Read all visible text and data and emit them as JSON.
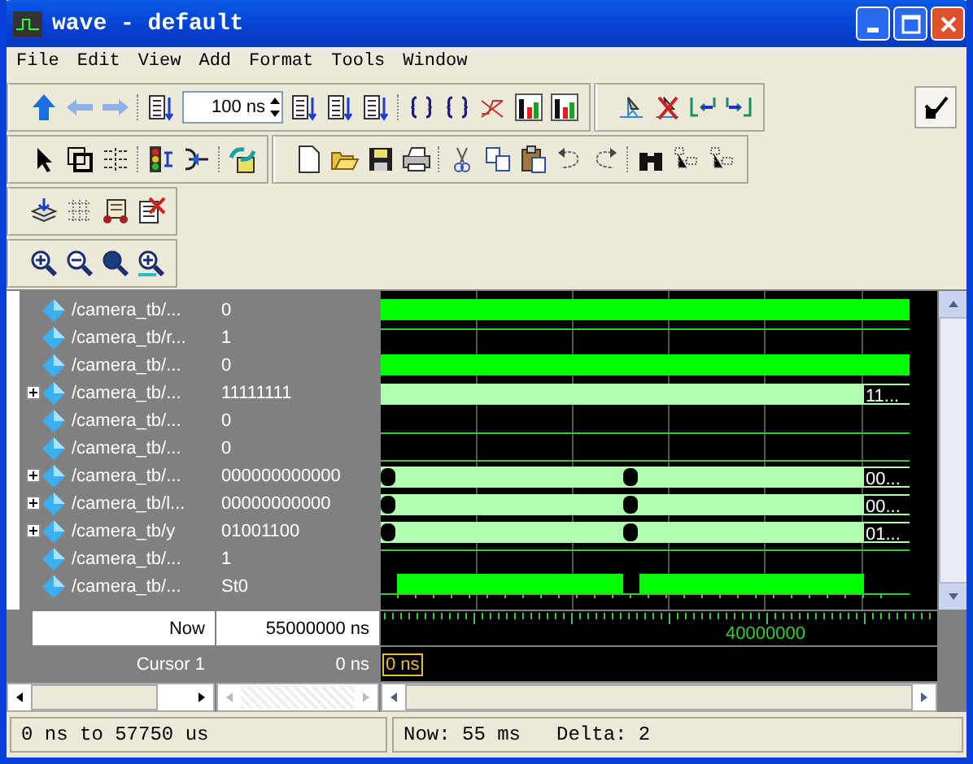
{
  "window": {
    "title": "wave - default"
  },
  "menu": [
    "File",
    "Edit",
    "View",
    "Add",
    "Format",
    "Tools",
    "Window"
  ],
  "toolbar": {
    "time_step": "100 ns"
  },
  "signals": [
    {
      "name": "/camera_tb/...",
      "value": "0",
      "expandable": false,
      "wave": {
        "kind": "block"
      }
    },
    {
      "name": "/camera_tb/r...",
      "value": "1",
      "expandable": false,
      "wave": {
        "kind": "high"
      }
    },
    {
      "name": "/camera_tb/...",
      "value": "0",
      "expandable": false,
      "wave": {
        "kind": "block"
      }
    },
    {
      "name": "/camera_tb/...",
      "value": "11111111",
      "expandable": true,
      "wave": {
        "kind": "bus",
        "end_label": "11..."
      }
    },
    {
      "name": "/camera_tb/...",
      "value": "0",
      "expandable": false,
      "wave": {
        "kind": "low"
      }
    },
    {
      "name": "/camera_tb/...",
      "value": "0",
      "expandable": false,
      "wave": {
        "kind": "low"
      }
    },
    {
      "name": "/camera_tb/...",
      "value": "000000000000",
      "expandable": true,
      "wave": {
        "kind": "bus-change",
        "end_label": "00..."
      }
    },
    {
      "name": "/camera_tb/l...",
      "value": "00000000000",
      "expandable": true,
      "wave": {
        "kind": "bus-change",
        "end_label": "00..."
      }
    },
    {
      "name": "/camera_tb/y",
      "value": "01001100",
      "expandable": true,
      "wave": {
        "kind": "bus-change",
        "end_label": "01..."
      }
    },
    {
      "name": "/camera_tb/...",
      "value": "1",
      "expandable": false,
      "wave": {
        "kind": "high"
      }
    },
    {
      "name": "/camera_tb/...",
      "value": "St0",
      "expandable": false,
      "wave": {
        "kind": "clock"
      }
    }
  ],
  "now": {
    "label": "Now",
    "value": "55000000 ns"
  },
  "timeline": {
    "label": "40000000"
  },
  "cursor": {
    "label": "Cursor 1",
    "value": "0 ns",
    "marker": "0 ns"
  },
  "status_bar": {
    "range": "0 ns to 57750 us",
    "now": "Now: 55 ms",
    "delta": "Delta: 2"
  }
}
